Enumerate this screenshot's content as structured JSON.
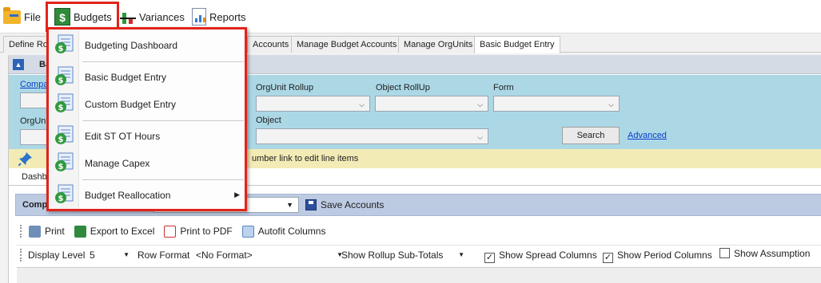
{
  "menubar": {
    "file_label": "File",
    "budgets_label": "Budgets",
    "variances_label": "Variances",
    "reports_label": "Reports"
  },
  "tabs": [
    {
      "label": "Define Ro"
    },
    {
      "label": "Accounts"
    },
    {
      "label": "Manage Budget Accounts"
    },
    {
      "label": "Manage OrgUnits"
    },
    {
      "label": "Basic Budget Entry"
    }
  ],
  "panel": {
    "title": "Ba"
  },
  "filters": {
    "company_label": "Compan",
    "orgunit_label": "OrgUnit",
    "orgunit_rollup_label": "OrgUnit Rollup",
    "object_rollup_label": "Object RollUp",
    "form_label": "Form",
    "object_label": "Object",
    "search_label": "Search",
    "advanced_label": "Advanced"
  },
  "infobar": {
    "text": "umber link to edit line items"
  },
  "subtabs": {
    "dashboard_label": "Dashbo"
  },
  "company_bar": {
    "label": "Comp",
    "save_accounts_label": "Save Accounts"
  },
  "toolbar": {
    "print_label": "Print",
    "export_excel_label": "Export to Excel",
    "print_pdf_label": "Print to PDF",
    "autofit_label": "Autofit Columns"
  },
  "options": {
    "display_level_label": "Display Level",
    "display_level_value": "5",
    "row_format_label": "Row Format",
    "row_format_value": "<No Format>",
    "show_rollup_label": "Show Rollup Sub-Totals",
    "show_spread_label": "Show Spread Columns",
    "show_spread_checked": true,
    "show_period_label": "Show Period Columns",
    "show_period_checked": true,
    "show_assumption_label": "Show Assumption",
    "show_assumption_checked": false,
    "check_mark": "✓"
  },
  "budgets_menu": {
    "items": [
      {
        "label": "Budgeting Dashboard"
      },
      {
        "label": "Basic Budget Entry"
      },
      {
        "label": "Custom Budget Entry"
      },
      {
        "label": "Edit ST  OT Hours"
      },
      {
        "label": "Manage Capex"
      },
      {
        "label": "Budget Reallocation"
      }
    ]
  },
  "colors": {
    "highlight": "#e2231a",
    "filter_bg": "#acd8e6",
    "info_bg": "#f2ebb5",
    "link": "#0b3fc9"
  }
}
